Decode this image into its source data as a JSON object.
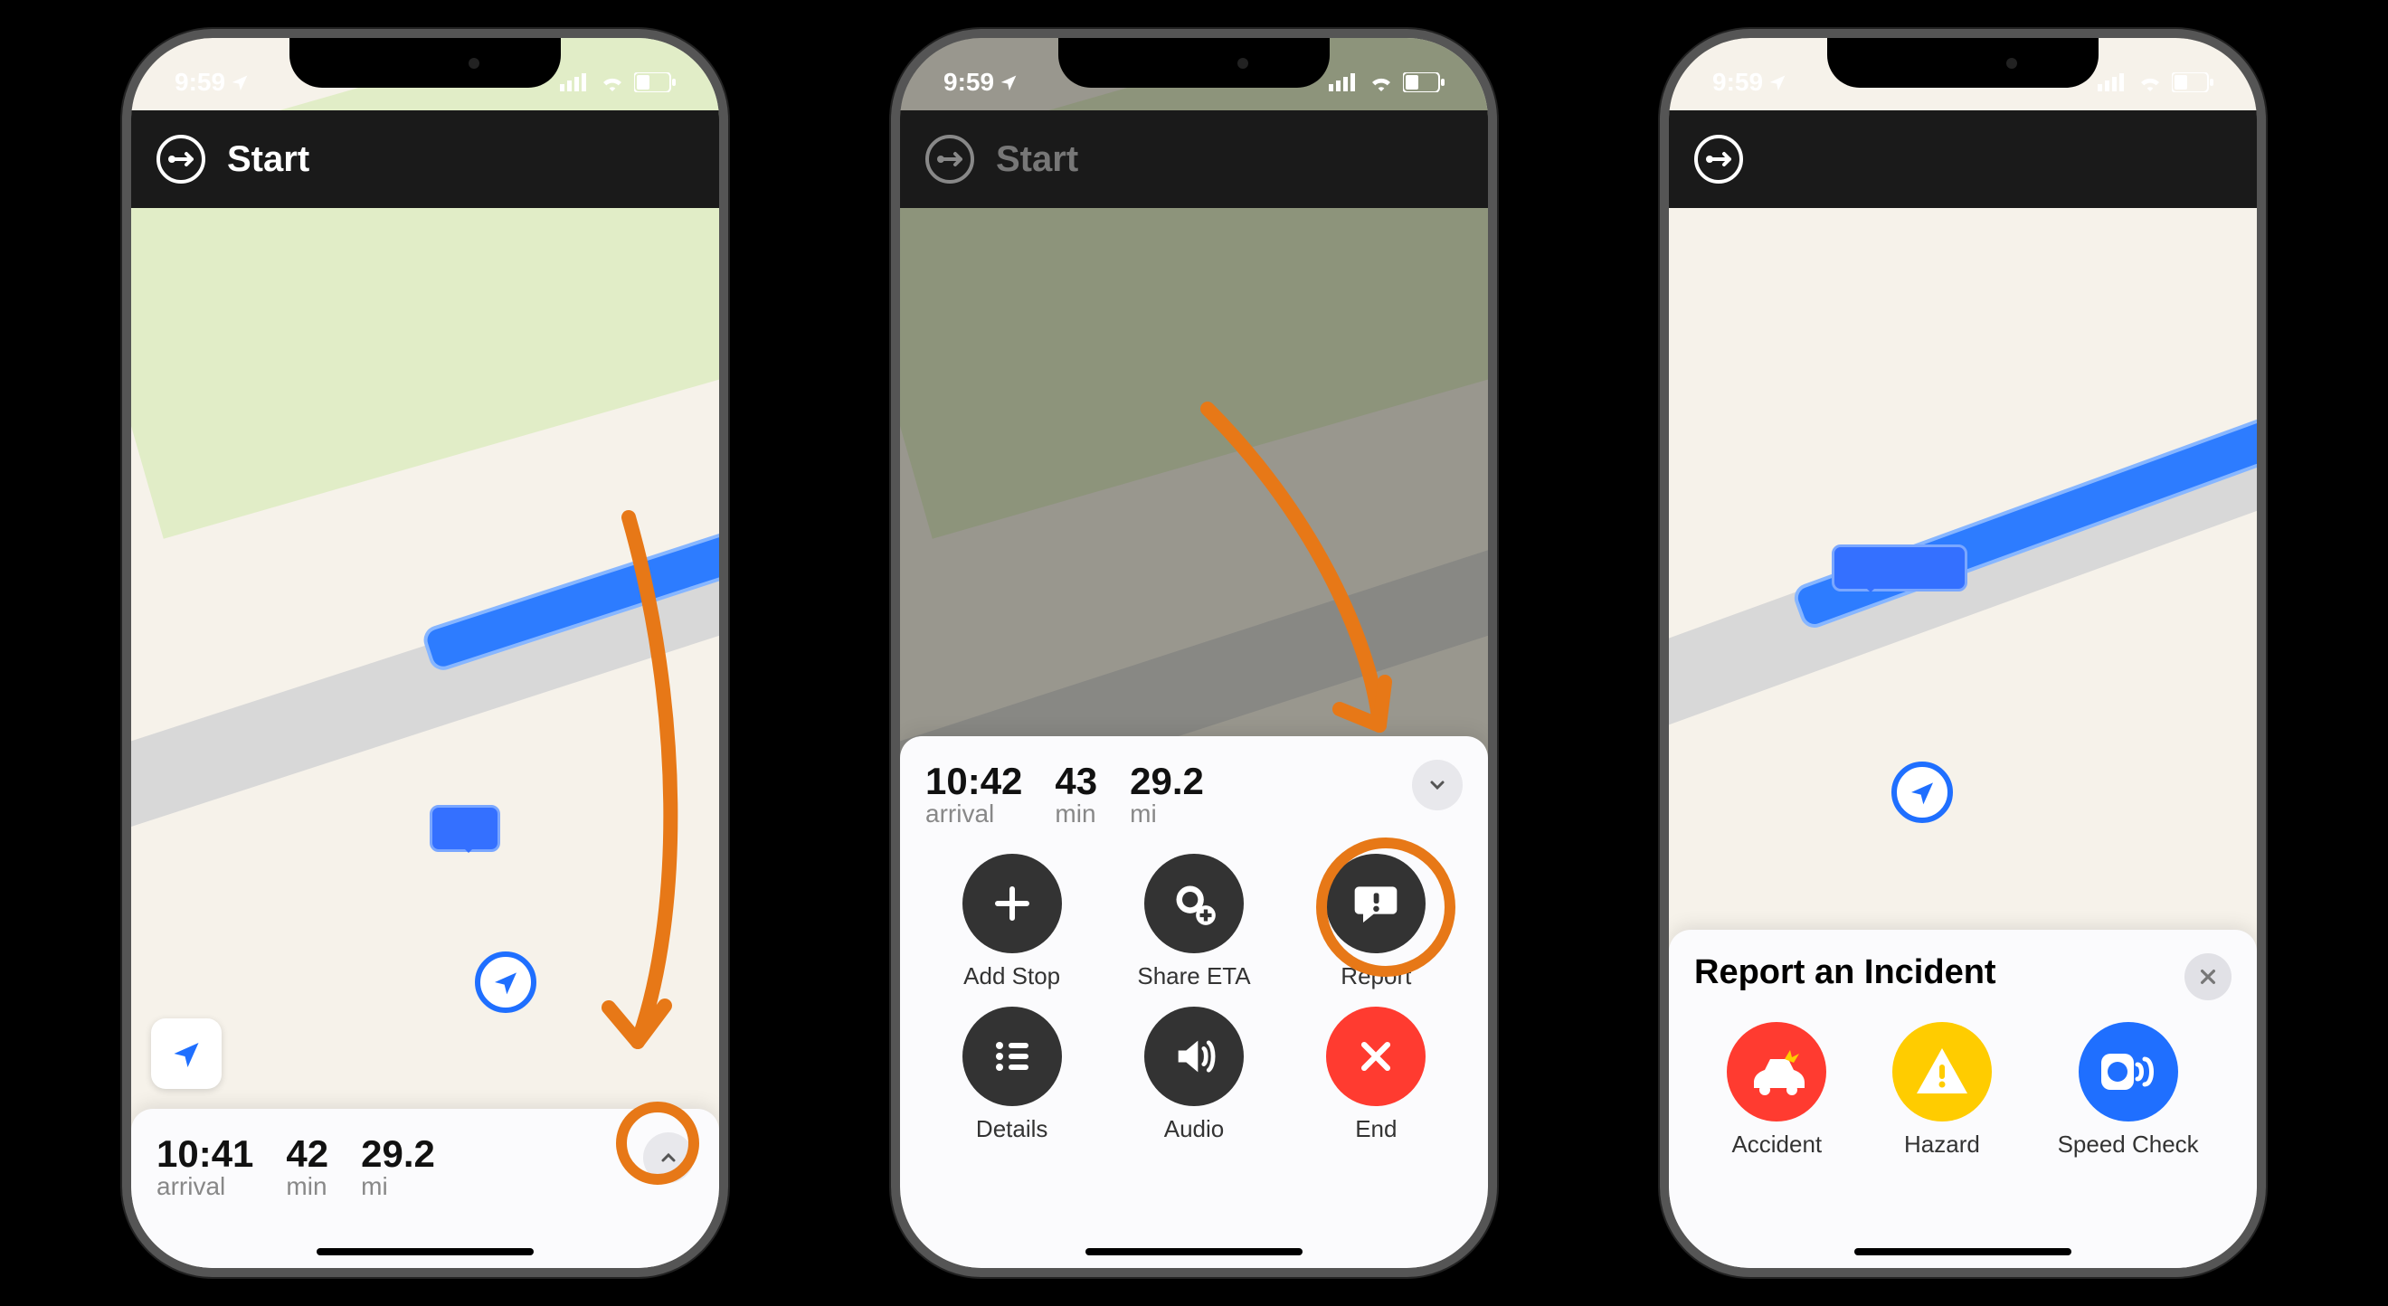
{
  "status": {
    "time": "9:59"
  },
  "nav": {
    "title": "Start"
  },
  "phone1": {
    "arrival_time": "10:41",
    "arrival_lbl": "arrival",
    "min_val": "42",
    "min_lbl": "min",
    "dist_val": "29.2",
    "dist_lbl": "mi"
  },
  "phone2": {
    "arrival_time": "10:42",
    "arrival_lbl": "arrival",
    "min_val": "43",
    "min_lbl": "min",
    "dist_val": "29.2",
    "dist_lbl": "mi",
    "actions": {
      "addstop": "Add Stop",
      "shareeta": "Share ETA",
      "report": "Report",
      "details": "Details",
      "audio": "Audio",
      "end": "End"
    }
  },
  "phone3": {
    "title": "Report an Incident",
    "accident": "Accident",
    "hazard": "Hazard",
    "speed": "Speed Check"
  }
}
